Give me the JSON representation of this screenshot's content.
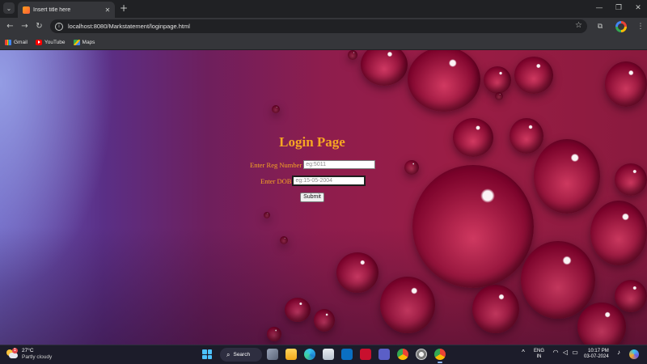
{
  "browser": {
    "tab": {
      "title": "Insert title here"
    },
    "url": {
      "host": "localhost",
      "rest": ":8080/Markstatement/loginpage.html"
    },
    "bookmarks": [
      {
        "label": "Gmail"
      },
      {
        "label": "YouTube"
      },
      {
        "label": "Maps"
      }
    ]
  },
  "page": {
    "title": "Login Page",
    "reg_label": "Enter Reg Number",
    "reg_placeholder": "eg:5011",
    "dob_label": "Enter DOB",
    "dob_placeholder": "eg:15-05-2004",
    "submit_label": "Submit"
  },
  "taskbar": {
    "weather": {
      "temp": "27°C",
      "condition": "Partly cloudy",
      "alert_count": "1"
    },
    "search_label": "Search",
    "lang": {
      "line1": "ENG",
      "line2": "IN"
    },
    "clock": {
      "time": "10:17 PM",
      "date": "03-07-2024"
    }
  },
  "colors": {
    "accent_text": "#f6a623",
    "background_tone": "#9b1d45",
    "chrome_dark": "#202124",
    "chrome_toolbar": "#35363a"
  }
}
